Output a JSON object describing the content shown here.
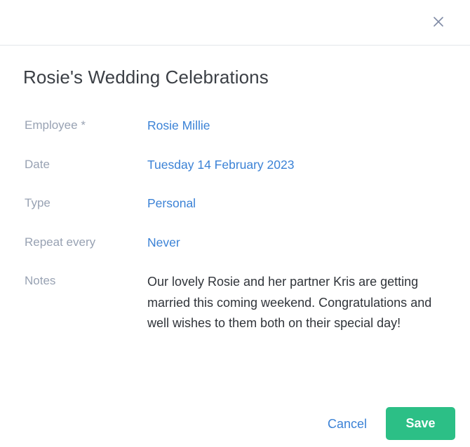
{
  "header": {
    "close_icon": "close-icon",
    "close_icon_color": "#7f8aa5"
  },
  "title": "Rosie's Wedding Celebrations",
  "fields": {
    "employee": {
      "label": "Employee *",
      "value": "Rosie Millie"
    },
    "date": {
      "label": "Date",
      "value": "Tuesday 14 February 2023"
    },
    "type": {
      "label": "Type",
      "value": "Personal"
    },
    "repeat": {
      "label": "Repeat every",
      "value": "Never"
    },
    "notes": {
      "label": "Notes",
      "value": "Our lovely Rosie and her partner Kris are getting married this coming weekend. Congratulations and well wishes to them both on their special day!"
    }
  },
  "footer": {
    "cancel_label": "Cancel",
    "save_label": "Save"
  },
  "colors": {
    "link": "#3b82d6",
    "label": "#98a2b3",
    "save_bg": "#2cbf86",
    "divider": "#e3e6ea"
  }
}
